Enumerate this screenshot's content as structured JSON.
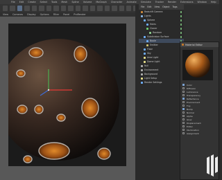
{
  "menu": [
    "File",
    "Edit",
    "Create",
    "Select",
    "Tools",
    "Mesh",
    "Spline",
    "Volume",
    "MoGraph",
    "Character",
    "Animate",
    "Simulate",
    "Tracker",
    "Render",
    "Extensions",
    "Window",
    "Help"
  ],
  "viewport_menu": [
    "View",
    "Cameras",
    "Display",
    "Options",
    "Filter",
    "Panel",
    "ProRender"
  ],
  "object_manager": {
    "tabs": [
      "File",
      "Edit",
      "View",
      "Object",
      "Tags"
    ],
    "items": [
      {
        "label": "Redshift Camera",
        "depth": 0,
        "color": "#d08a3a",
        "selected": false
      },
      {
        "label": "Lights",
        "depth": 0,
        "color": "#8ab8e8",
        "selected": false
      },
      {
        "label": "Sphere",
        "depth": 1,
        "color": "#6fb0ff",
        "selected": false
      },
      {
        "label": "Holes",
        "depth": 2,
        "color": "#6fb0ff",
        "selected": false
      },
      {
        "label": "Cloner",
        "depth": 2,
        "color": "#6fd06f",
        "selected": false
      },
      {
        "label": "Random",
        "depth": 3,
        "color": "#8fd08f",
        "selected": false
      },
      {
        "label": "Subdivision Surface",
        "depth": 1,
        "color": "#6fb0ff",
        "selected": false
      },
      {
        "label": "Boole",
        "depth": 2,
        "color": "#6fb0ff",
        "selected": true
      },
      {
        "label": "Emitter",
        "depth": 2,
        "color": "#d0c36f",
        "selected": false
      },
      {
        "label": "Floor",
        "depth": 1,
        "color": "#6fb0ff",
        "selected": false
      },
      {
        "label": "Sky",
        "depth": 1,
        "color": "#6fb0ff",
        "selected": false
      },
      {
        "label": "Area Light",
        "depth": 1,
        "color": "#e8e08a",
        "selected": false
      },
      {
        "label": "Dome Light",
        "depth": 1,
        "color": "#e8e08a",
        "selected": false
      },
      {
        "label": "Null",
        "depth": 0,
        "color": "#b0b0b0",
        "selected": false
      },
      {
        "label": "Environment",
        "depth": 0,
        "color": "#b0b0b0",
        "selected": false
      },
      {
        "label": "Background",
        "depth": 0,
        "color": "#b0b0b0",
        "selected": false
      },
      {
        "label": "Light Setup",
        "depth": 0,
        "color": "#e8e08a",
        "selected": false
      },
      {
        "label": "Render Settings",
        "depth": 0,
        "color": "#6fb0ff",
        "selected": false
      }
    ]
  },
  "material_editor": {
    "title": "Material Editor",
    "channels": [
      {
        "label": "Color",
        "on": true
      },
      {
        "label": "Diffusion",
        "on": false
      },
      {
        "label": "Luminance",
        "on": false
      },
      {
        "label": "Transparency",
        "on": false
      },
      {
        "label": "Reflectance",
        "on": true
      },
      {
        "label": "Environment",
        "on": false
      },
      {
        "label": "Fog",
        "on": false
      },
      {
        "label": "Bump",
        "on": true
      },
      {
        "label": "Normal",
        "on": false
      },
      {
        "label": "Alpha",
        "on": false
      },
      {
        "label": "Glow",
        "on": false
      },
      {
        "label": "Displacement",
        "on": false
      },
      {
        "label": "Editor",
        "on": false
      },
      {
        "label": "Illumination",
        "on": false
      },
      {
        "label": "Assignment",
        "on": false
      }
    ]
  },
  "colors": {
    "accent": "#c77a2a",
    "selection": "#3e4a5c",
    "panel": "#2a2a2a"
  }
}
